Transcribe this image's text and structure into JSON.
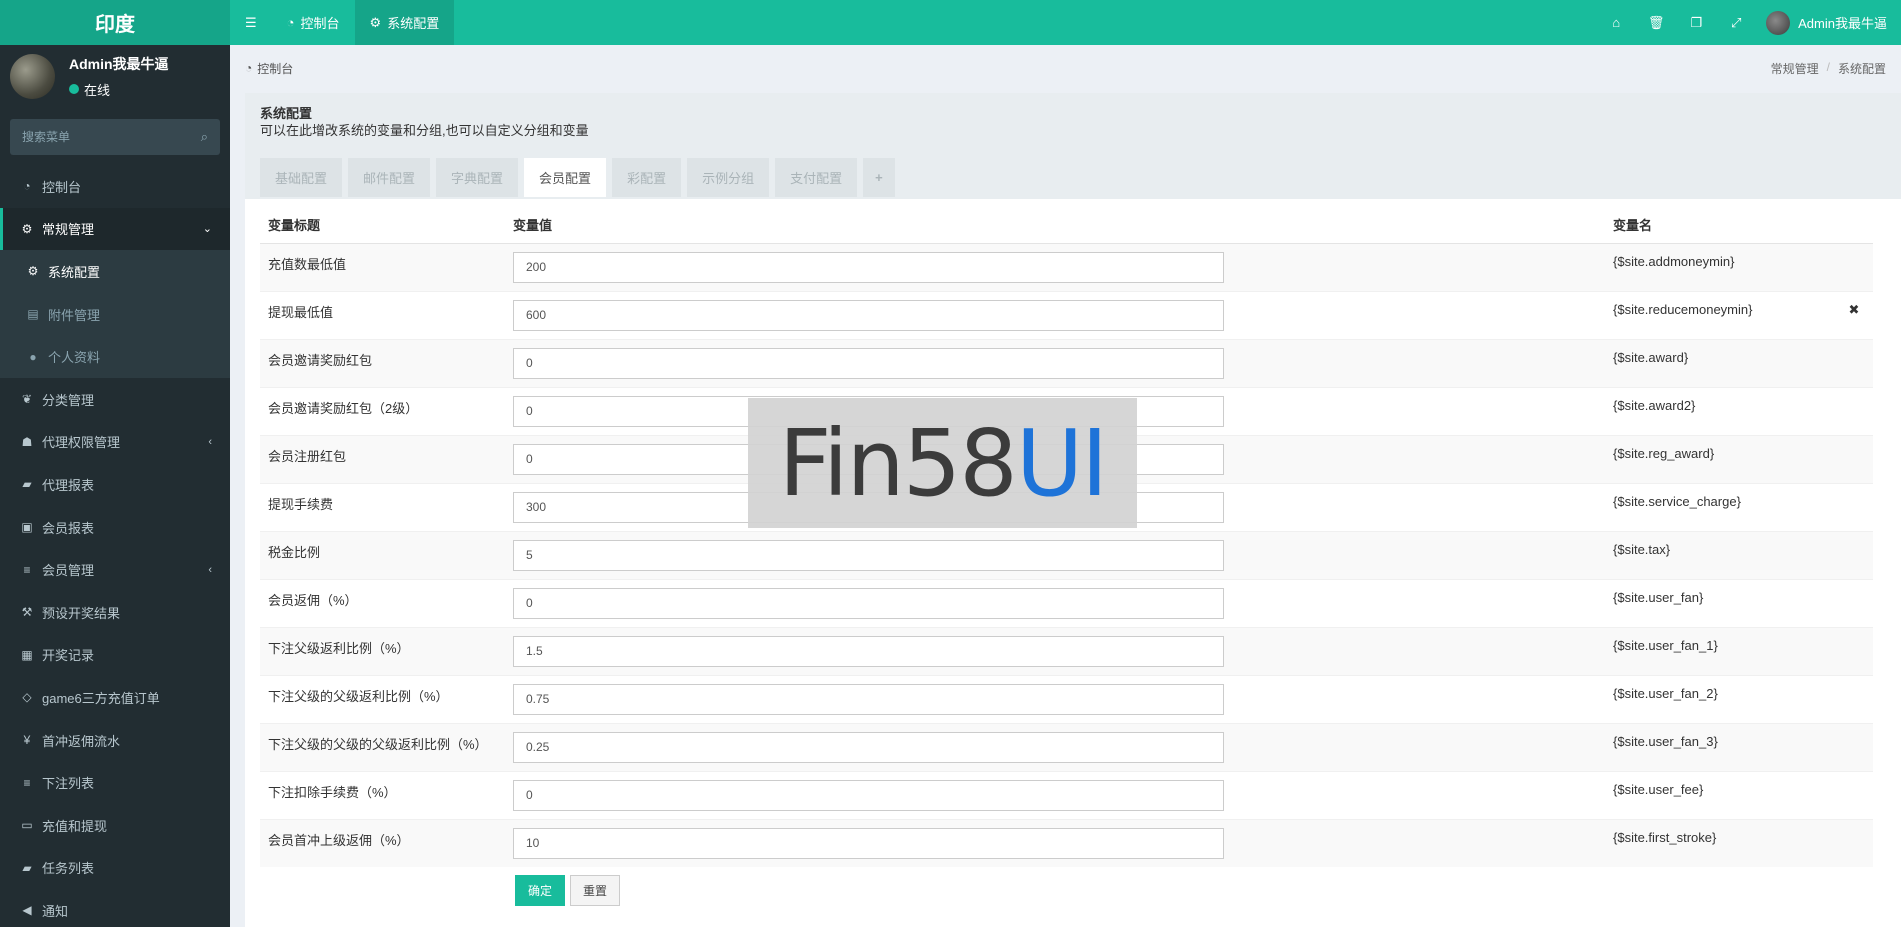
{
  "header": {
    "logo": "印度",
    "nav": [
      {
        "label": "控制台"
      },
      {
        "label": "系统配置"
      }
    ],
    "username": "Admin我最牛逼"
  },
  "sidebar": {
    "username": "Admin我最牛逼",
    "status": "在线",
    "search_placeholder": "搜索菜单",
    "items": [
      {
        "label": "控制台",
        "icon": "dashboard-icon"
      },
      {
        "label": "常规管理",
        "icon": "cogs-icon"
      },
      {
        "label": "系统配置",
        "icon": "cog-icon"
      },
      {
        "label": "附件管理",
        "icon": "file-image-icon"
      },
      {
        "label": "个人资料",
        "icon": "user-icon"
      },
      {
        "label": "分类管理",
        "icon": "leaf-icon"
      },
      {
        "label": "代理权限管理",
        "icon": "group-icon"
      },
      {
        "label": "代理报表",
        "icon": "book-icon"
      },
      {
        "label": "会员报表",
        "icon": "address-book-icon"
      },
      {
        "label": "会员管理",
        "icon": "list-icon"
      },
      {
        "label": "预设开奖结果",
        "icon": "gavel-icon"
      },
      {
        "label": "开奖记录",
        "icon": "calendar-icon"
      },
      {
        "label": "game6三方充值订单",
        "icon": "diamond-icon"
      },
      {
        "label": "首冲返佣流水",
        "icon": "yen-icon"
      },
      {
        "label": "下注列表",
        "icon": "list-icon"
      },
      {
        "label": "充值和提现",
        "icon": "money-icon"
      },
      {
        "label": "任务列表",
        "icon": "book-icon"
      },
      {
        "label": "通知",
        "icon": "bullhorn-icon"
      }
    ]
  },
  "breadcrumb": {
    "home": "控制台",
    "path": [
      "常规管理",
      "系统配置"
    ]
  },
  "panel": {
    "title": "系统配置",
    "description": "可以在此增改系统的变量和分组,也可以自定义分组和变量",
    "tabs": [
      "基础配置",
      "邮件配置",
      "字典配置",
      "会员配置",
      "彩配置",
      "示例分组",
      "支付配置",
      "+"
    ],
    "active_tab": "会员配置"
  },
  "table": {
    "headers": {
      "title": "变量标题",
      "value": "变量值",
      "name": "变量名"
    },
    "rows": [
      {
        "title": "充值数最低值",
        "value": "200",
        "name": "{$site.addmoneymin}"
      },
      {
        "title": "提现最低值",
        "value": "600",
        "name": "{$site.reducemoneymin}"
      },
      {
        "title": "会员邀请奖励红包",
        "value": "0",
        "name": "{$site.award}"
      },
      {
        "title": "会员邀请奖励红包（2级）",
        "value": "0",
        "name": "{$site.award2}"
      },
      {
        "title": "会员注册红包",
        "value": "0",
        "name": "{$site.reg_award}"
      },
      {
        "title": "提现手续费",
        "value": "300",
        "name": "{$site.service_charge}"
      },
      {
        "title": "税金比例",
        "value": "5",
        "name": "{$site.tax}"
      },
      {
        "title": "会员返佣（%）",
        "value": "0",
        "name": "{$site.user_fan}"
      },
      {
        "title": "下注父级返利比例（%）",
        "value": "1.5",
        "name": "{$site.user_fan_1}"
      },
      {
        "title": "下注父级的父级返利比例（%）",
        "value": "0.75",
        "name": "{$site.user_fan_2}"
      },
      {
        "title": "下注父级的父级的父级返利比例（%）",
        "value": "0.25",
        "name": "{$site.user_fan_3}"
      },
      {
        "title": "下注扣除手续费（%）",
        "value": "0",
        "name": "{$site.user_fee}"
      },
      {
        "title": "会员首冲上级返佣（%）",
        "value": "10",
        "name": "{$site.first_stroke}"
      }
    ]
  },
  "buttons": {
    "submit": "确定",
    "reset": "重置"
  },
  "watermark": {
    "part1": "Fin58",
    "part2": "UI"
  },
  "colors": {
    "accent": "#18bc9c",
    "sidebar": "#222d32",
    "watermark_blue": "#1e73d8"
  }
}
